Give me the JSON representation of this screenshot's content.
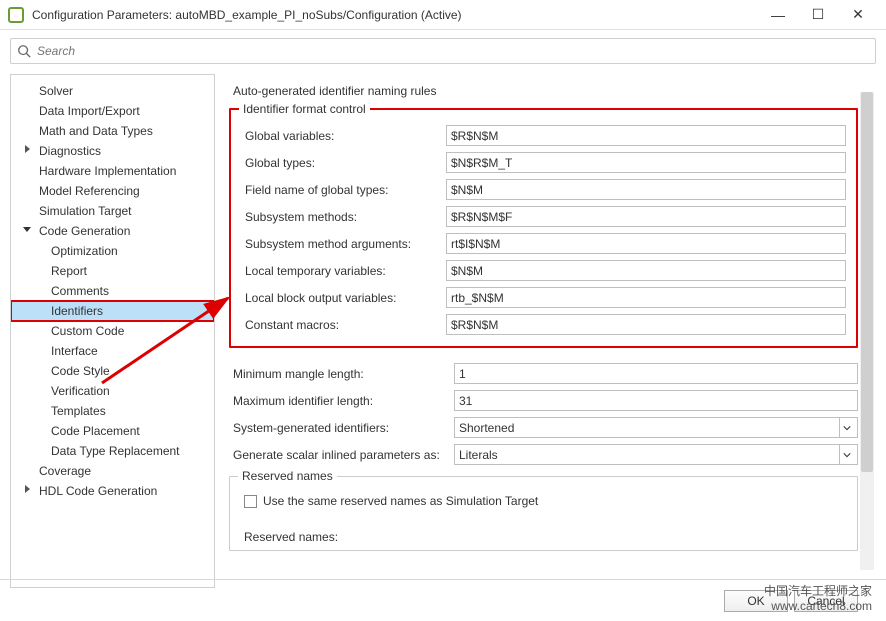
{
  "window": {
    "title": "Configuration Parameters: autoMBD_example_PI_noSubs/Configuration (Active)"
  },
  "search": {
    "placeholder": "Search"
  },
  "sidebar": {
    "items": [
      {
        "label": "Solver",
        "level": 1
      },
      {
        "label": "Data Import/Export",
        "level": 1
      },
      {
        "label": "Math and Data Types",
        "level": 1
      },
      {
        "label": "Diagnostics",
        "level": 1,
        "caret": "right"
      },
      {
        "label": "Hardware Implementation",
        "level": 1
      },
      {
        "label": "Model Referencing",
        "level": 1
      },
      {
        "label": "Simulation Target",
        "level": 1
      },
      {
        "label": "Code Generation",
        "level": 1,
        "caret": "down"
      },
      {
        "label": "Optimization",
        "level": 2
      },
      {
        "label": "Report",
        "level": 2
      },
      {
        "label": "Comments",
        "level": 2
      },
      {
        "label": "Identifiers",
        "level": 2,
        "selected": true
      },
      {
        "label": "Custom Code",
        "level": 2
      },
      {
        "label": "Interface",
        "level": 2
      },
      {
        "label": "Code Style",
        "level": 2
      },
      {
        "label": "Verification",
        "level": 2
      },
      {
        "label": "Templates",
        "level": 2
      },
      {
        "label": "Code Placement",
        "level": 2
      },
      {
        "label": "Data Type Replacement",
        "level": 2
      },
      {
        "label": "Coverage",
        "level": 1
      },
      {
        "label": "HDL Code Generation",
        "level": 1,
        "caret": "right"
      }
    ]
  },
  "main": {
    "section_title": "Auto-generated identifier naming rules",
    "format_group": {
      "legend": "Identifier format control",
      "rows": [
        {
          "label": "Global variables:",
          "value": "$R$N$M"
        },
        {
          "label": "Global types:",
          "value": "$N$R$M_T"
        },
        {
          "label": "Field name of global types:",
          "value": "$N$M"
        },
        {
          "label": "Subsystem methods:",
          "value": "$R$N$M$F"
        },
        {
          "label": "Subsystem method arguments:",
          "value": "rt$I$N$M"
        },
        {
          "label": "Local temporary variables:",
          "value": "$N$M"
        },
        {
          "label": "Local block output variables:",
          "value": "rtb_$N$M"
        },
        {
          "label": "Constant macros:",
          "value": "$R$N$M"
        }
      ]
    },
    "extra_rows": [
      {
        "label": "Minimum mangle length:",
        "value": "1",
        "type": "text"
      },
      {
        "label": "Maximum identifier length:",
        "value": "31",
        "type": "text"
      },
      {
        "label": "System-generated identifiers:",
        "value": "Shortened",
        "type": "combo"
      },
      {
        "label": "Generate scalar inlined parameters as:",
        "value": "Literals",
        "type": "combo"
      }
    ],
    "reserved_group": {
      "legend": "Reserved names",
      "checkbox_label": "Use the same reserved names as Simulation Target",
      "reserved_label": "Reserved names:"
    }
  },
  "footer": {
    "ok": "OK",
    "cancel": "Cancel"
  },
  "watermark": {
    "line1": "中国汽车工程师之家",
    "line2": "www.cartech8.com"
  }
}
